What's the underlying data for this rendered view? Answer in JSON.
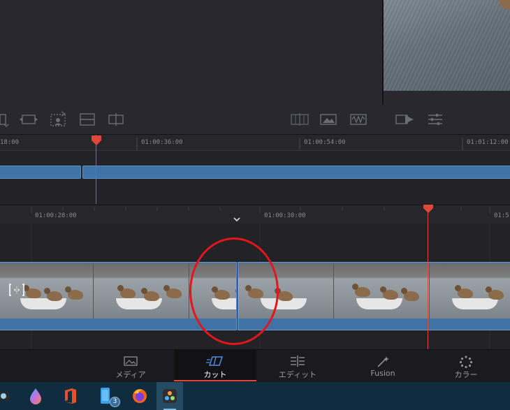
{
  "timeline_upper": {
    "ticks": [
      "18:00",
      "01:00:36:00",
      "01:00:54:00",
      "01:01:12:00"
    ]
  },
  "timeline_lower": {
    "ticks": [
      "01:00:28:00",
      "01:00:30:00",
      "01:5"
    ]
  },
  "page_nav": {
    "items": [
      {
        "label": "メディア",
        "icon": "media-icon"
      },
      {
        "label": "カット",
        "icon": "cut-icon",
        "active": true
      },
      {
        "label": "エディット",
        "icon": "edit-icon"
      },
      {
        "label": "Fusion",
        "icon": "fusion-icon"
      },
      {
        "label": "カラー",
        "icon": "color-icon"
      }
    ]
  },
  "taskbar": {
    "apps": [
      "camera-app-icon",
      "drop-app-icon",
      "office-icon",
      "phone-link-icon",
      "firefox-icon",
      "davinci-resolve-icon"
    ],
    "phone_badge": "3"
  },
  "colors": {
    "clip_blue": "#3f73a6",
    "playhead_red": "#e0463a",
    "annotation_red": "#e3161b",
    "taskbar": "#102d3f"
  }
}
